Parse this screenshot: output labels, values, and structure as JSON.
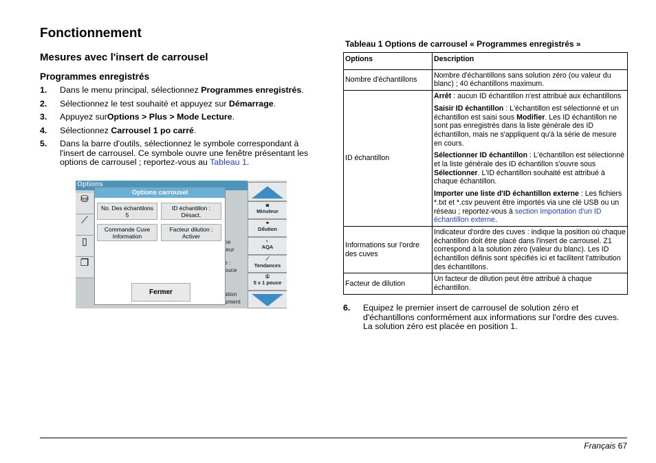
{
  "page": {
    "title": "Fonctionnement",
    "section": "Mesures avec l'insert de carrousel",
    "subsection": "Programmes enregistrés",
    "footer": {
      "lang": "Français",
      "page": "67"
    }
  },
  "steps": [
    {
      "n": "1.",
      "pre": "Dans le menu principal, sélectionnez ",
      "bold": "Programmes enregistrés",
      "post": "."
    },
    {
      "n": "2.",
      "pre": "Sélectionnez le test souhaité et appuyez sur ",
      "bold": "Démarrage",
      "post": "."
    },
    {
      "n": "3.",
      "pre": "Appuyez sur",
      "bold": "Options > Plus > Mode Lecture",
      "post": "."
    },
    {
      "n": "4.",
      "pre": "Sélectionnez ",
      "bold": "Carrousel 1 po carré",
      "post": "."
    },
    {
      "n": "5.",
      "pre": "Dans la barre d'outils, sélectionnez le symbole correspondant à l'insert de carrousel. Ce symbole ouvre une fenêtre présentant les options de carrousel ; reportez-vous au ",
      "link": "Tableau 1",
      "post": "."
    }
  ],
  "step6": {
    "n": "6.",
    "text": "Equipez le premier insert de carrousel de solution zéro et d'échantillons conformément aux informations sur l'ordre des cuves. La solution zéro est placée en position 1."
  },
  "device": {
    "top_title": "Options",
    "dialog_title": "Options carrousel",
    "buttons": [
      [
        "No. Des échantilons",
        "5"
      ],
      [
        "ID échantillon :",
        "Désact."
      ],
      [
        "Commande Cuve",
        "Information"
      ],
      [
        "Facteur dilution :",
        "Activer"
      ]
    ],
    "close": "Fermer",
    "right": [
      "Minuteur",
      "Dilution",
      "AQA",
      "Tendances",
      "5 x 1 pouce"
    ],
    "bg": [
      "ne",
      "teur",
      "e :",
      "ouce",
      "ation",
      "ument"
    ]
  },
  "table": {
    "title": "Tableau 1 Options de carrousel « Programmes enregistrés »",
    "headers": [
      "Options",
      "Description"
    ],
    "r1": {
      "o": "Nombre d'échantillons",
      "d": "Nombre d'échantillons sans solution zéro (ou valeur du blanc) ; 40 échantillons maximum."
    },
    "r2": {
      "o": "ID échantillon",
      "p1b": "Arrêt",
      "p1": " : aucun ID échantillon n'est attribué aux échantillons",
      "p2b": "Saisir ID échantillon",
      "p2": " : L'échantillon est sélectionné et un échantillon est saisi sous ",
      "p2b2": "Modifier",
      "p2c": ". Les ID échantillon ne sont pas enregistrés dans la liste générale des ID échantillon, mais ne s'appliquent qu'à la série de mesure en cours.",
      "p3b": "Sélectionner ID échantillon",
      "p3": " : L'échantillon est sélectionné et la liste générale des ID échantillon s'ouvre sous ",
      "p3b2": "Sélectionner",
      "p3c": ". L'ID échantillon souhaité est attribué à chaque échantillon.",
      "p4b": "Importer une liste d'ID échantillon externe",
      "p4": " : Les fichiers *.txt et *.csv peuvent être importés via une clé USB ou un réseau ; reportez-vous à ",
      "p4l": "section Importation d'un ID échantillon externe",
      "p4c": "."
    },
    "r3": {
      "o": "Informations sur l'ordre des cuves",
      "d": "Indicateur d'ordre des cuves : indique la position où chaque échantillon doit être placé dans l'insert de carrousel. Z1 correspond à la solution zéro (valeur du blanc). Les ID échantillon définis sont spécifiés ici et facilitent l'attribution des échantillons."
    },
    "r4": {
      "o": "Facteur de dilution",
      "d": "Un facteur de dilution peut être attribué à chaque échantillon."
    }
  },
  "colors": {
    "link": "#1a3fd6",
    "device_accent": "#3d8dc5"
  }
}
